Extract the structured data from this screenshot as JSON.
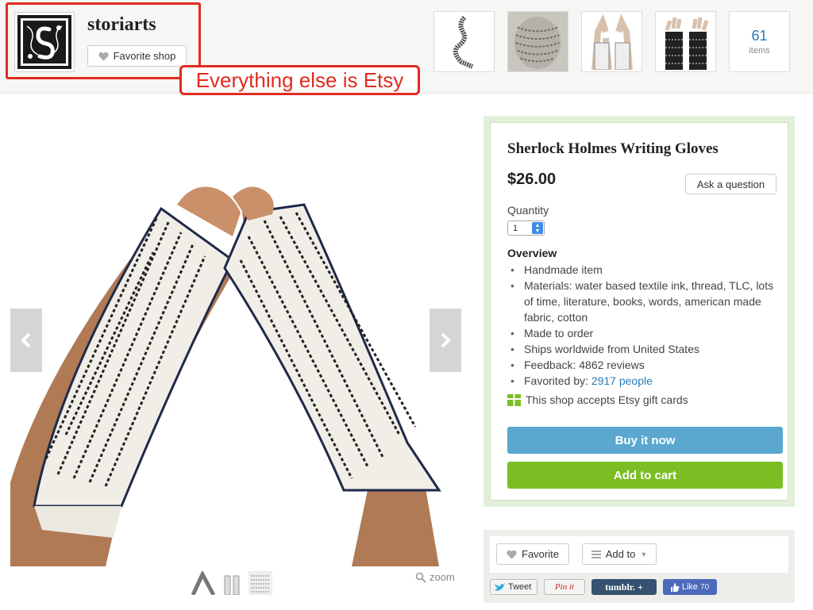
{
  "shop": {
    "name": "storiarts",
    "favorite_label": "Favorite shop",
    "items_count": "61",
    "items_label": "items"
  },
  "annotation": {
    "text": "Everything else is Etsy",
    "color": "#e02b20"
  },
  "listing": {
    "title": "Sherlock Holmes Writing Gloves",
    "price": "$26.00",
    "ask_label": "Ask a question",
    "quantity_label": "Quantity",
    "quantity_value": "1",
    "overview_title": "Overview",
    "overview": [
      {
        "text": "Handmade item"
      },
      {
        "text": "Materials: water based textile ink, thread, TLC, lots of time, literature, books, words, american made fabric, cotton"
      },
      {
        "text": "Made to order"
      },
      {
        "text": "Ships worldwide from United States"
      },
      {
        "text": "Feedback: 4862 reviews"
      },
      {
        "text": "Favorited by: ",
        "link": "2917 people"
      }
    ],
    "gift_text": "This shop accepts Etsy gift cards",
    "buy_label": "Buy it now",
    "cart_label": "Add to cart"
  },
  "actions": {
    "favorite_label": "Favorite",
    "addto_label": "Add to"
  },
  "social": {
    "tweet": "Tweet",
    "pinit": "Pin it",
    "tumblr": "tumblr. +",
    "like": "Like",
    "like_count": "70"
  },
  "gallery": {
    "zoom_label": "zoom"
  },
  "colors": {
    "buy": "#5aa7d0",
    "cart": "#7bbe23",
    "link": "#2b7bb9",
    "panel": "#e2f0d9"
  }
}
